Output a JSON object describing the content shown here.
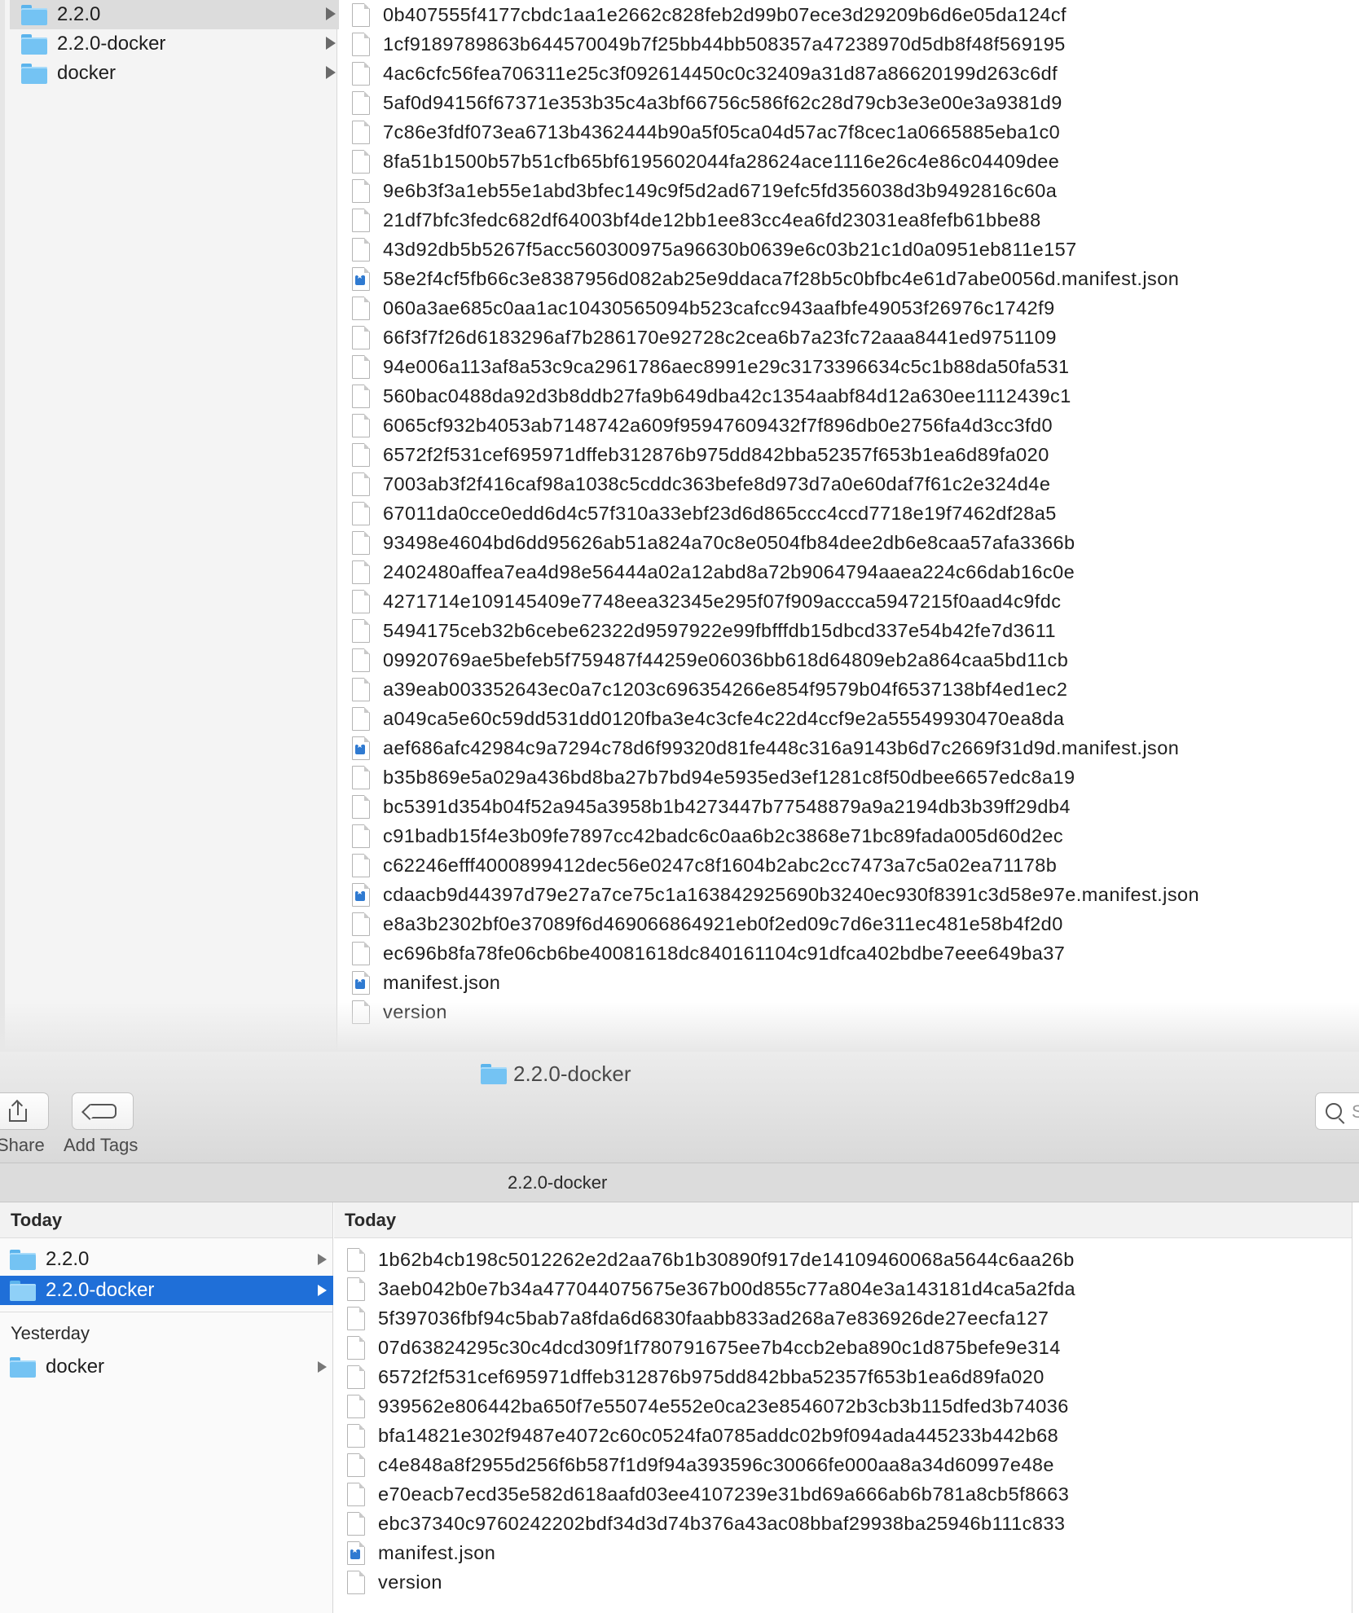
{
  "upper_window": {
    "sidebar": [
      {
        "label": "2.2.0",
        "selected": true
      },
      {
        "label": "2.2.0-docker",
        "selected": false
      },
      {
        "label": "docker",
        "selected": false
      }
    ],
    "files": [
      {
        "name": "0b407555f4177cbdc1aa1e2662c828feb2d99b07ece3d29209b6d6e05da124cf",
        "icon": "document-icon"
      },
      {
        "name": "1cf9189789863b644570049b7f25bb44bb508357a47238970d5db8f48f569195",
        "icon": "document-icon"
      },
      {
        "name": "4ac6cfc56fea706311e25c3f092614450c0c32409a31d87a86620199d263c6df",
        "icon": "document-icon"
      },
      {
        "name": "5af0d94156f67371e353b35c4a3bf66756c586f62c28d79cb3e3e00e3a9381d9",
        "icon": "document-icon"
      },
      {
        "name": "7c86e3fdf073ea6713b4362444b90a5f05ca04d57ac7f8cec1a0665885eba1c0",
        "icon": "document-icon"
      },
      {
        "name": "8fa51b1500b57b51cfb65bf6195602044fa28624ace1116e26c4e86c04409dee",
        "icon": "document-icon"
      },
      {
        "name": "9e6b3f3a1eb55e1abd3bfec149c9f5d2ad6719efc5fd356038d3b9492816c60a",
        "icon": "document-icon"
      },
      {
        "name": "21df7bfc3fedc682df64003bf4de12bb1ee83cc4ea6fd23031ea8fefb61bbe88",
        "icon": "document-icon"
      },
      {
        "name": "43d92db5b5267f5acc560300975a96630b0639e6c03b21c1d0a0951eb811e157",
        "icon": "document-icon"
      },
      {
        "name": "58e2f4cf5fb66c3e8387956d082ab25e9ddaca7f28b5c0bfbc4e61d7abe0056d.manifest.json",
        "icon": "json-file-icon"
      },
      {
        "name": "060a3ae685c0aa1ac10430565094b523cafcc943aafbfe49053f26976c1742f9",
        "icon": "document-icon"
      },
      {
        "name": "66f3f7f26d6183296af7b286170e92728c2cea6b7a23fc72aaa8441ed9751109",
        "icon": "document-icon"
      },
      {
        "name": "94e006a113af8a53c9ca2961786aec8991e29c3173396634c5c1b88da50fa531",
        "icon": "document-icon"
      },
      {
        "name": "560bac0488da92d3b8ddb27fa9b649dba42c1354aabf84d12a630ee1112439c1",
        "icon": "document-icon"
      },
      {
        "name": "6065cf932b4053ab7148742a609f95947609432f7f896db0e2756fa4d3cc3fd0",
        "icon": "document-icon"
      },
      {
        "name": "6572f2f531cef695971dffeb312876b975dd842bba52357f653b1ea6d89fa020",
        "icon": "document-icon"
      },
      {
        "name": "7003ab3f2f416caf98a1038c5cddc363befe8d973d7a0e60daf7f61c2e324d4e",
        "icon": "document-icon"
      },
      {
        "name": "67011da0cce0edd6d4c57f310a33ebf23d6d865ccc4ccd7718e19f7462df28a5",
        "icon": "document-icon"
      },
      {
        "name": "93498e4604bd6dd95626ab51a824a70c8e0504fb84dee2db6e8caa57afa3366b",
        "icon": "document-icon"
      },
      {
        "name": "2402480affea7ea4d98e56444a02a12abd8a72b9064794aaea224c66dab16c0e",
        "icon": "document-icon"
      },
      {
        "name": "4271714e109145409e7748eea32345e295f07f909accca5947215f0aad4c9fdc",
        "icon": "document-icon"
      },
      {
        "name": "5494175ceb32b6cebe62322d9597922e99fbfffdb15dbcd337e54b42fe7d3611",
        "icon": "document-icon"
      },
      {
        "name": "09920769ae5befeb5f759487f44259e06036bb618d64809eb2a864caa5bd11cb",
        "icon": "document-icon"
      },
      {
        "name": "a39eab003352643ec0a7c1203c696354266e854f9579b04f6537138bf4ed1ec2",
        "icon": "document-icon"
      },
      {
        "name": "a049ca5e60c59dd531dd0120fba3e4c3cfe4c22d4ccf9e2a55549930470ea8da",
        "icon": "document-icon"
      },
      {
        "name": "aef686afc42984c9a7294c78d6f99320d81fe448c316a9143b6d7c2669f31d9d.manifest.json",
        "icon": "json-file-icon"
      },
      {
        "name": "b35b869e5a029a436bd8ba27b7bd94e5935ed3ef1281c8f50dbee6657edc8a19",
        "icon": "document-icon"
      },
      {
        "name": "bc5391d354b04f52a945a3958b1b4273447b77548879a9a2194db3b39ff29db4",
        "icon": "document-icon"
      },
      {
        "name": "c91badb15f4e3b09fe7897cc42badc6c0aa6b2c3868e71bc89fada005d60d2ec",
        "icon": "document-icon"
      },
      {
        "name": "c62246efff4000899412dec56e0247c8f1604b2abc2cc7473a7c5a02ea71178b",
        "icon": "document-icon"
      },
      {
        "name": "cdaacb9d44397d79e27a7ce75c1a163842925690b3240ec930f8391c3d58e97e.manifest.json",
        "icon": "json-file-icon"
      },
      {
        "name": "e8a3b2302bf0e37089f6d469066864921eb0f2ed09c7d6e311ec481e58b4f2d0",
        "icon": "document-icon"
      },
      {
        "name": "ec696b8fa78fe06cb6be40081618dc840161104c91dfca402bdbe7eee649ba37",
        "icon": "document-icon"
      },
      {
        "name": "manifest.json",
        "icon": "json-file-icon"
      },
      {
        "name": "version",
        "icon": "document-icon"
      }
    ]
  },
  "lower_window": {
    "title": "2.2.0-docker",
    "toolbar": {
      "share_label": "Share",
      "add_tags_label": "Add Tags",
      "search_placeholder": "S"
    },
    "path_bar": "2.2.0-docker",
    "sidebar": {
      "header": "Today",
      "groups": [
        {
          "label": "",
          "items": [
            {
              "label": "2.2.0",
              "selected": false
            },
            {
              "label": "2.2.0-docker",
              "selected": true
            }
          ]
        },
        {
          "label": "Yesterday",
          "items": [
            {
              "label": "docker",
              "selected": false
            }
          ]
        }
      ]
    },
    "content": {
      "header": "Today",
      "files": [
        {
          "name": "1b62b4cb198c5012262e2d2aa76b1b30890f917de14109460068a5644c6aa26b",
          "icon": "document-icon"
        },
        {
          "name": "3aeb042b0e7b34a477044075675e367b00d855c77a804e3a143181d4ca5a2fda",
          "icon": "document-icon"
        },
        {
          "name": "5f397036fbf94c5bab7a8fda6d6830faabb833ad268a7e836926de27eecfa127",
          "icon": "document-icon"
        },
        {
          "name": "07d63824295c30c4dcd309f1f780791675ee7b4ccb2eba890c1d875befe9e314",
          "icon": "document-icon"
        },
        {
          "name": "6572f2f531cef695971dffeb312876b975dd842bba52357f653b1ea6d89fa020",
          "icon": "document-icon"
        },
        {
          "name": "939562e806442ba650f7e55074e552e0ca23e8546072b3cb3b115dfed3b74036",
          "icon": "document-icon"
        },
        {
          "name": "bfa14821e302f9487e4072c60c0524fa0785addc02b9f094ada445233b442b68",
          "icon": "document-icon"
        },
        {
          "name": "c4e848a8f2955d256f6b587f1d9f94a393596c30066fe000aa8a34d60997e48e",
          "icon": "document-icon"
        },
        {
          "name": "e70eacb7ecd35e582d618aafd03ee4107239e31bd69a666ab6b781a8cb5f8663",
          "icon": "document-icon"
        },
        {
          "name": "ebc37340c9760242202bdf34d3d74b376a43ac08bbaf29938ba25946b111c833",
          "icon": "document-icon"
        },
        {
          "name": "manifest.json",
          "icon": "json-file-icon"
        },
        {
          "name": "version",
          "icon": "document-icon"
        }
      ]
    }
  },
  "colors": {
    "selection_blue": "#1f6fd8",
    "folder_blue": "#74c3f3",
    "json_badge_blue": "#2f7ad1"
  }
}
